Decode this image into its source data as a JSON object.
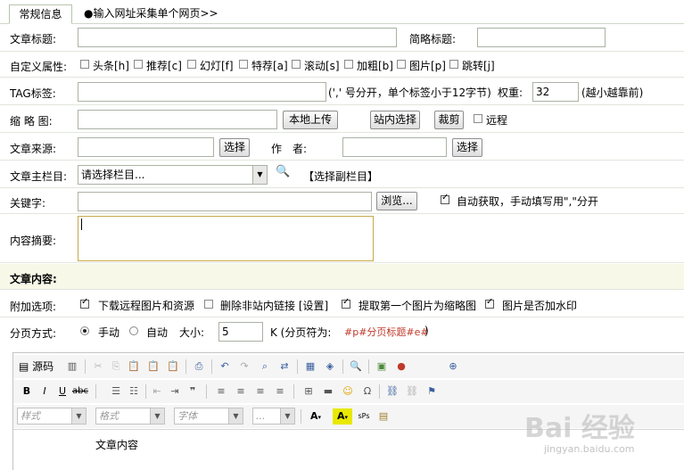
{
  "tabs": {
    "normal": "常规信息",
    "collect": "●输入网址采集单个网页>>"
  },
  "title_row": {
    "label": "文章标题:",
    "short_label": "简略标题:"
  },
  "attrs": {
    "label": "自定义属性:",
    "items": [
      "头条[h]",
      "推荐[c]",
      "幻灯[f]",
      "特荐[a]",
      "滚动[s]",
      "加粗[b]",
      "图片[p]",
      "跳转[j]"
    ]
  },
  "tag": {
    "label": "TAG标签:",
    "hint": "(',' 号分开，单个标签小于12字节)",
    "weight_label": "权重:",
    "weight_value": "32",
    "weight_hint": "(越小越靠前)"
  },
  "thumb": {
    "label": "缩 略 图:",
    "upload": "本地上传",
    "site_select": "站内选择",
    "crop": "裁剪",
    "remote": "远程"
  },
  "source": {
    "label": "文章来源:",
    "select": "选择",
    "author_label": "作　者:",
    "author_select": "选择"
  },
  "column": {
    "label": "文章主栏目:",
    "placeholder": "请选择栏目...",
    "sub": "【选择副栏目】"
  },
  "keywords": {
    "label": "关键字:",
    "browse": "浏览...",
    "auto": "自动获取，手动填写用\",\"分开"
  },
  "summary": {
    "label": "内容摘要:"
  },
  "content_section": {
    "label": "文章内容:"
  },
  "extra": {
    "label": "附加选项:",
    "items": [
      {
        "text": "下载远程图片和资源",
        "checked": true
      },
      {
        "text": "删除非站内链接 [设置]",
        "checked": false
      },
      {
        "text": "提取第一个图片为缩略图",
        "checked": true
      },
      {
        "text": "图片是否加水印",
        "checked": true
      }
    ]
  },
  "paging": {
    "label": "分页方式:",
    "manual": "手动",
    "auto": "自动",
    "size_label": "大小:",
    "size_value": "5",
    "unit": "K (分页符为:",
    "marker": "#p#分页标题#e#",
    "close": ")"
  },
  "editor": {
    "source_btn": "源码",
    "combos": [
      "样式",
      "格式",
      "字体",
      "..."
    ],
    "content": "文章内容"
  },
  "watermark": {
    "main": "Bai 经验",
    "sub": "jingyan.baidu.com"
  }
}
